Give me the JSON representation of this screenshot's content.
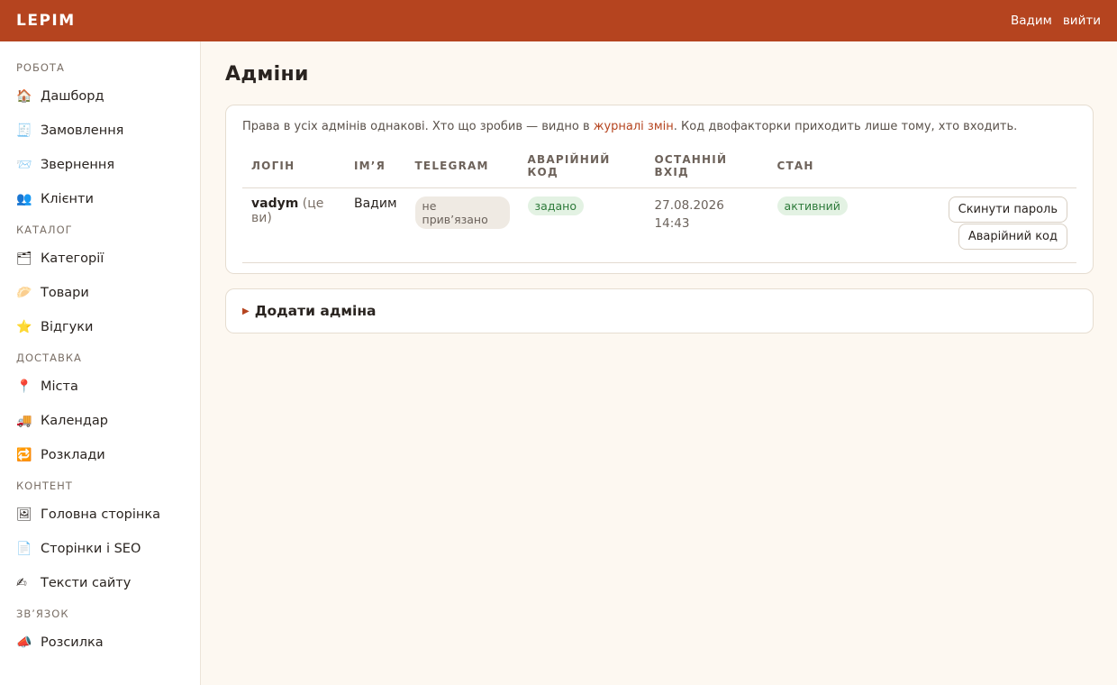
{
  "header": {
    "brand": "LEPIM",
    "user": "Вадим",
    "logout": "вийти"
  },
  "sidebar": {
    "sections": [
      {
        "label": "РОБОТА",
        "items": [
          {
            "icon": "home-icon",
            "glyph": "🏠",
            "label": "Дашборд"
          },
          {
            "icon": "receipt-icon",
            "glyph": "🧾",
            "label": "Замовлення"
          },
          {
            "icon": "envelope-icon",
            "glyph": "📨",
            "label": "Звернення"
          },
          {
            "icon": "users-icon",
            "glyph": "👥",
            "label": "Клієнти"
          }
        ]
      },
      {
        "label": "КАТАЛОГ",
        "items": [
          {
            "icon": "folder-icon",
            "glyph": "🗂",
            "label": "Категорії"
          },
          {
            "icon": "dumpling-icon",
            "glyph": "🥟",
            "label": "Товари"
          },
          {
            "icon": "star-icon",
            "glyph": "⭐",
            "label": "Відгуки"
          }
        ]
      },
      {
        "label": "ДОСТАВКА",
        "items": [
          {
            "icon": "pin-icon",
            "glyph": "📍",
            "label": "Міста"
          },
          {
            "icon": "truck-icon",
            "glyph": "🚚",
            "label": "Календар"
          },
          {
            "icon": "repeat-icon",
            "glyph": "🔁",
            "label": "Розклади"
          }
        ]
      },
      {
        "label": "КОНТЕНТ",
        "items": [
          {
            "icon": "picture-icon",
            "glyph": "🖼",
            "label": "Головна сторінка"
          },
          {
            "icon": "page-icon",
            "glyph": "📄",
            "label": "Сторінки і SEO"
          },
          {
            "icon": "pen-icon",
            "glyph": "✍",
            "label": "Тексти сайту"
          }
        ]
      },
      {
        "label": "ЗВ’ЯЗОК",
        "items": [
          {
            "icon": "megaphone-icon",
            "glyph": "📣",
            "label": "Розсилка"
          }
        ]
      }
    ]
  },
  "main": {
    "title": "Адміни",
    "note_before": "Права в усіх адмінів однакові. Хто що зробив — видно в ",
    "note_link": "журналі змін",
    "note_after": ". Код двофакторки приходить лише тому, хто входить.",
    "columns": [
      "ЛОГІН",
      "ІМ’Я",
      "TELEGRAM",
      "АВАРІЙНИЙ КОД",
      "ОСТАННІЙ ВХІД",
      "СТАН"
    ],
    "rows": [
      {
        "login": "vadym",
        "me": " (це ви)",
        "name": "Вадим",
        "telegram": "не прив’язано",
        "emergency": "задано",
        "last_date": "27.08.2026",
        "last_time": "14:43",
        "state": "активний",
        "btn_reset": "Скинути пароль",
        "btn_emergency": "Аварійний код"
      }
    ],
    "add_admin": "Додати адміна"
  },
  "colors": {
    "accent": "#b5441f",
    "background": "#fdf8f1",
    "pill_green": "#e3f2e3"
  }
}
